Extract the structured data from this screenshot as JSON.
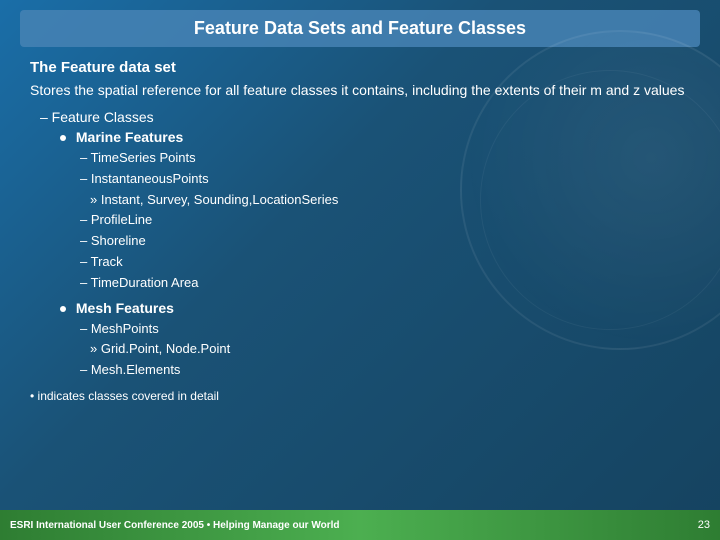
{
  "page": {
    "title": "Feature Data Sets and Feature Classes",
    "background_color": "#1a5276",
    "accent_color": "#4682b4"
  },
  "content": {
    "main_heading": "The Feature data set",
    "main_body": "Stores the spatial reference for all feature classes it contains, including the extents of their m and z values",
    "dash_label": "– Feature Classes",
    "marine_bullet": "Marine Features",
    "marine_items": [
      "– TimeSeries Points",
      "– InstantaneousPoints",
      "» Instant, Survey, Sounding,LocationSeries",
      "– ProfileLine",
      "– Shoreline",
      "– Track",
      "– TimeDuration Area"
    ],
    "mesh_bullet": "Mesh Features",
    "mesh_sub": [
      "– MeshPoints",
      "» Grid.Point, Node.Point",
      "– Mesh.Elements"
    ],
    "footer_note": "• indicates classes covered in detail",
    "bottom_left": "ESRI International User Conference 2005 • Helping Manage our World",
    "page_number": "23"
  }
}
